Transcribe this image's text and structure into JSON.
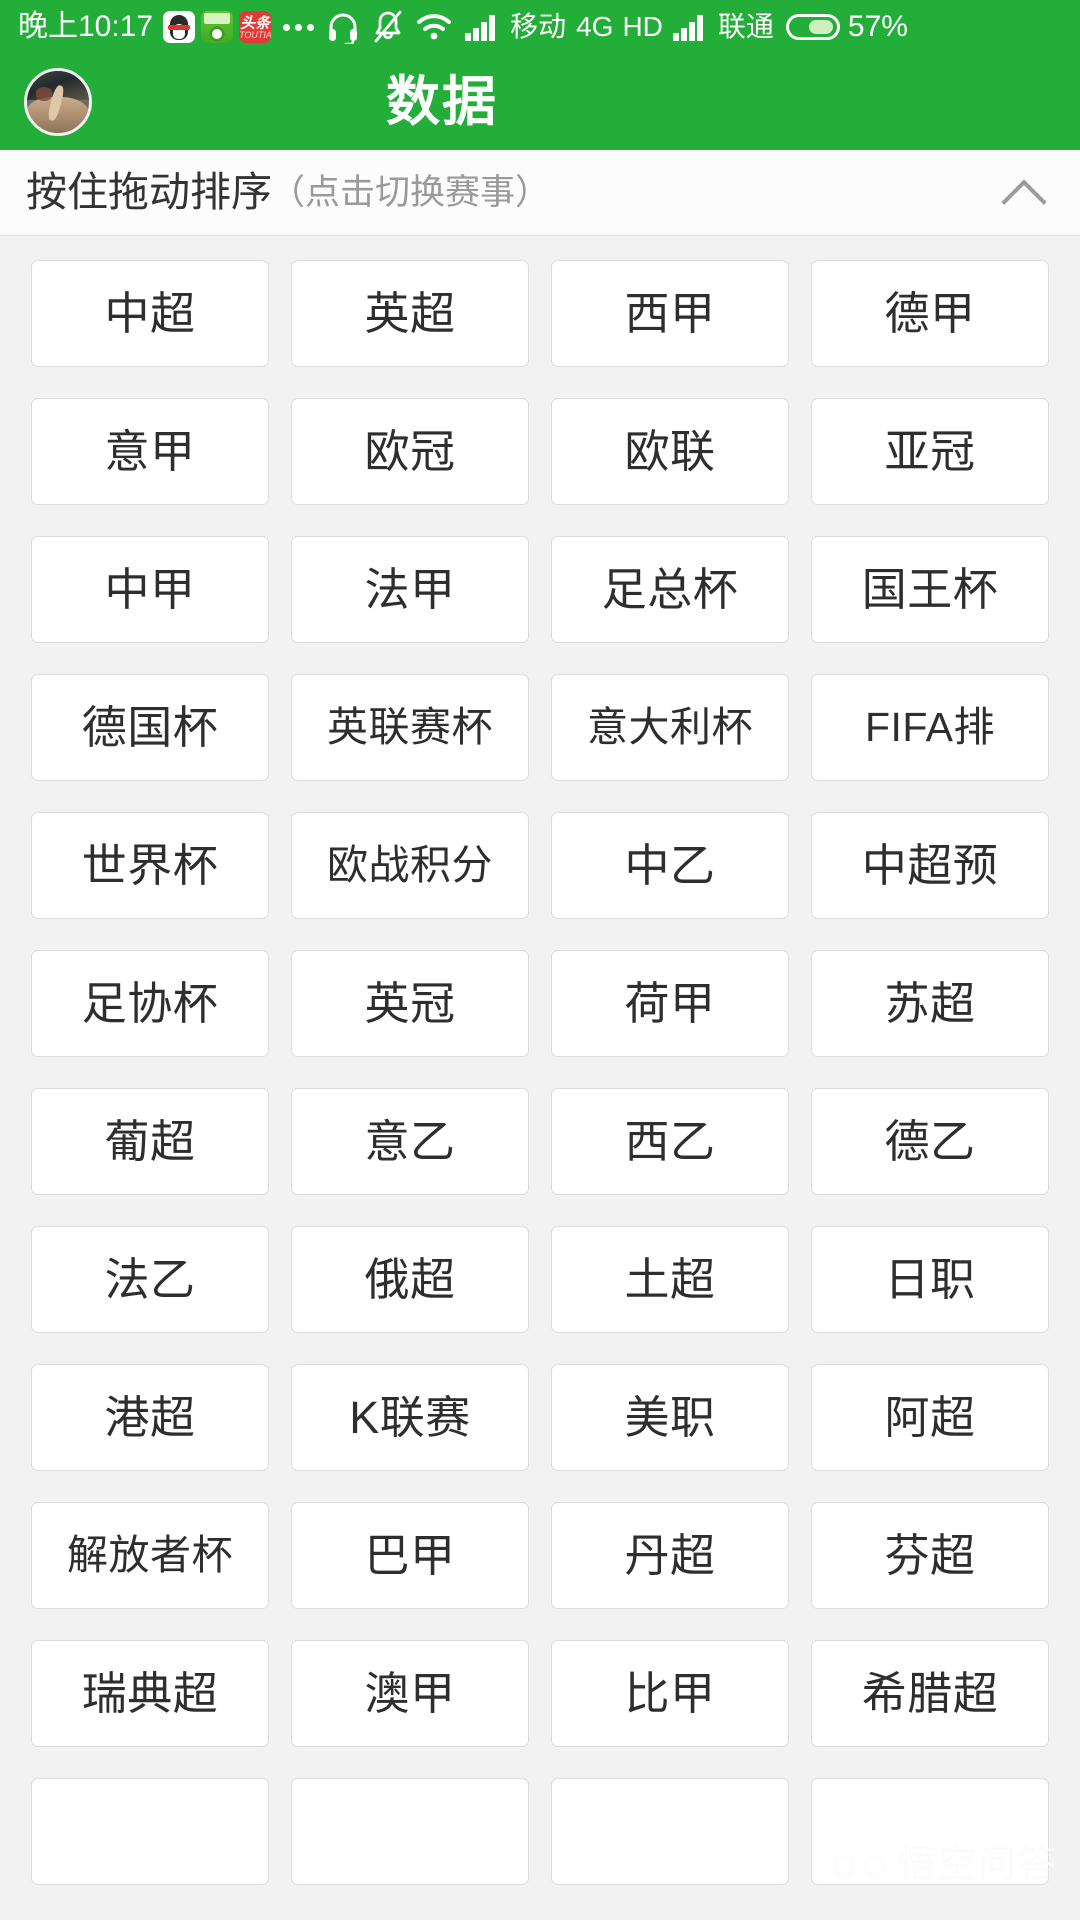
{
  "status_bar": {
    "clock": "晚上10:17",
    "app_icons": [
      {
        "name": "qq-icon",
        "label": "QQ"
      },
      {
        "name": "soccer-app-icon",
        "label": "球"
      },
      {
        "name": "toutiao-icon",
        "label": "头条",
        "sub": "TOUTIAO"
      }
    ],
    "overflow_dots": "•••",
    "icons": [
      "headset-icon",
      "bell-muted-icon",
      "wifi-icon",
      "signal-icon"
    ],
    "carrier_primary": "移动",
    "network": "4G",
    "hd_label": "HD",
    "carrier_secondary": "联通",
    "battery_percent": "57%",
    "battery_level": 57
  },
  "app_bar": {
    "title": "数据",
    "avatar_name": "user-avatar"
  },
  "sort_bar": {
    "main_text": "按住拖动排序",
    "sub_text": "（点击切换赛事）",
    "collapse_icon": "chevron-up-icon"
  },
  "colors": {
    "brand_green": "#22ae38",
    "page_background": "#f2f2f2",
    "cell_background": "#ffffff",
    "cell_border": "#dcdcdc",
    "text_primary": "#2e2e2e",
    "text_muted": "#9a9a9a"
  },
  "leagues": [
    "中超",
    "英超",
    "西甲",
    "德甲",
    "意甲",
    "欧冠",
    "欧联",
    "亚冠",
    "中甲",
    "法甲",
    "足总杯",
    "国王杯",
    "德国杯",
    "英联赛杯",
    "意大利杯",
    "FIFA排",
    "世界杯",
    "欧战积分",
    "中乙",
    "中超预",
    "足协杯",
    "英冠",
    "荷甲",
    "苏超",
    "葡超",
    "意乙",
    "西乙",
    "德乙",
    "法乙",
    "俄超",
    "土超",
    "日职",
    "港超",
    "K联赛",
    "美职",
    "阿超",
    "解放者杯",
    "巴甲",
    "丹超",
    "芬超",
    "瑞典超",
    "澳甲",
    "比甲",
    "希腊超",
    "",
    "",
    "",
    ""
  ],
  "watermark": {
    "text": "悟空问答",
    "icon": "owl-icon"
  }
}
